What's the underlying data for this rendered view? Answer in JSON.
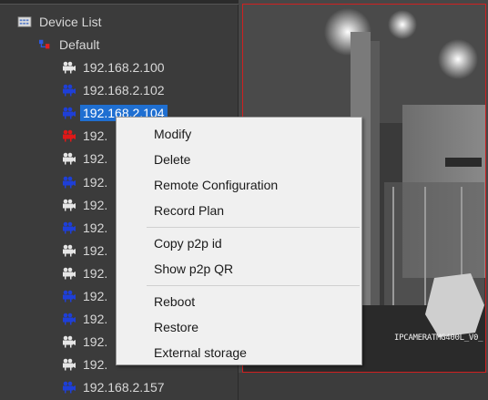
{
  "tree": {
    "root_label": "Device List",
    "group_label": "Default",
    "devices": [
      {
        "ip": "192.168.2.100",
        "icon": "camera-icon-white"
      },
      {
        "ip": "192.168.2.102",
        "icon": "camera-icon-blue"
      },
      {
        "ip": "192.168.2.104",
        "icon": "camera-icon-blue",
        "selected": true
      },
      {
        "ip": "192.",
        "icon": "camera-icon-red"
      },
      {
        "ip": "192.",
        "icon": "camera-icon-white"
      },
      {
        "ip": "192.",
        "icon": "camera-icon-blue"
      },
      {
        "ip": "192.",
        "icon": "camera-icon-white"
      },
      {
        "ip": "192.",
        "icon": "camera-icon-blue"
      },
      {
        "ip": "192.",
        "icon": "camera-icon-white"
      },
      {
        "ip": "192.",
        "icon": "camera-icon-white"
      },
      {
        "ip": "192.",
        "icon": "camera-icon-blue"
      },
      {
        "ip": "192.",
        "icon": "camera-icon-blue"
      },
      {
        "ip": "192.",
        "icon": "camera-icon-white"
      },
      {
        "ip": "192.",
        "icon": "camera-icon-white"
      },
      {
        "ip": "192.168.2.157",
        "icon": "camera-icon-blue"
      }
    ],
    "icon_colors": {
      "white": "#e6e6e6",
      "blue": "#1e3fd8",
      "red": "#e01818"
    },
    "selected_color": "#1f6fd1"
  },
  "video": {
    "osd_text": "IPCAMERATMG400L_V0_",
    "frame_border_color": "#d02020"
  },
  "context_menu": {
    "groups": [
      [
        "Modify",
        "Delete",
        "Remote Configuration",
        "Record Plan"
      ],
      [
        "Copy p2p id",
        "Show p2p QR"
      ],
      [
        "Reboot",
        "Restore",
        "External storage"
      ]
    ]
  }
}
